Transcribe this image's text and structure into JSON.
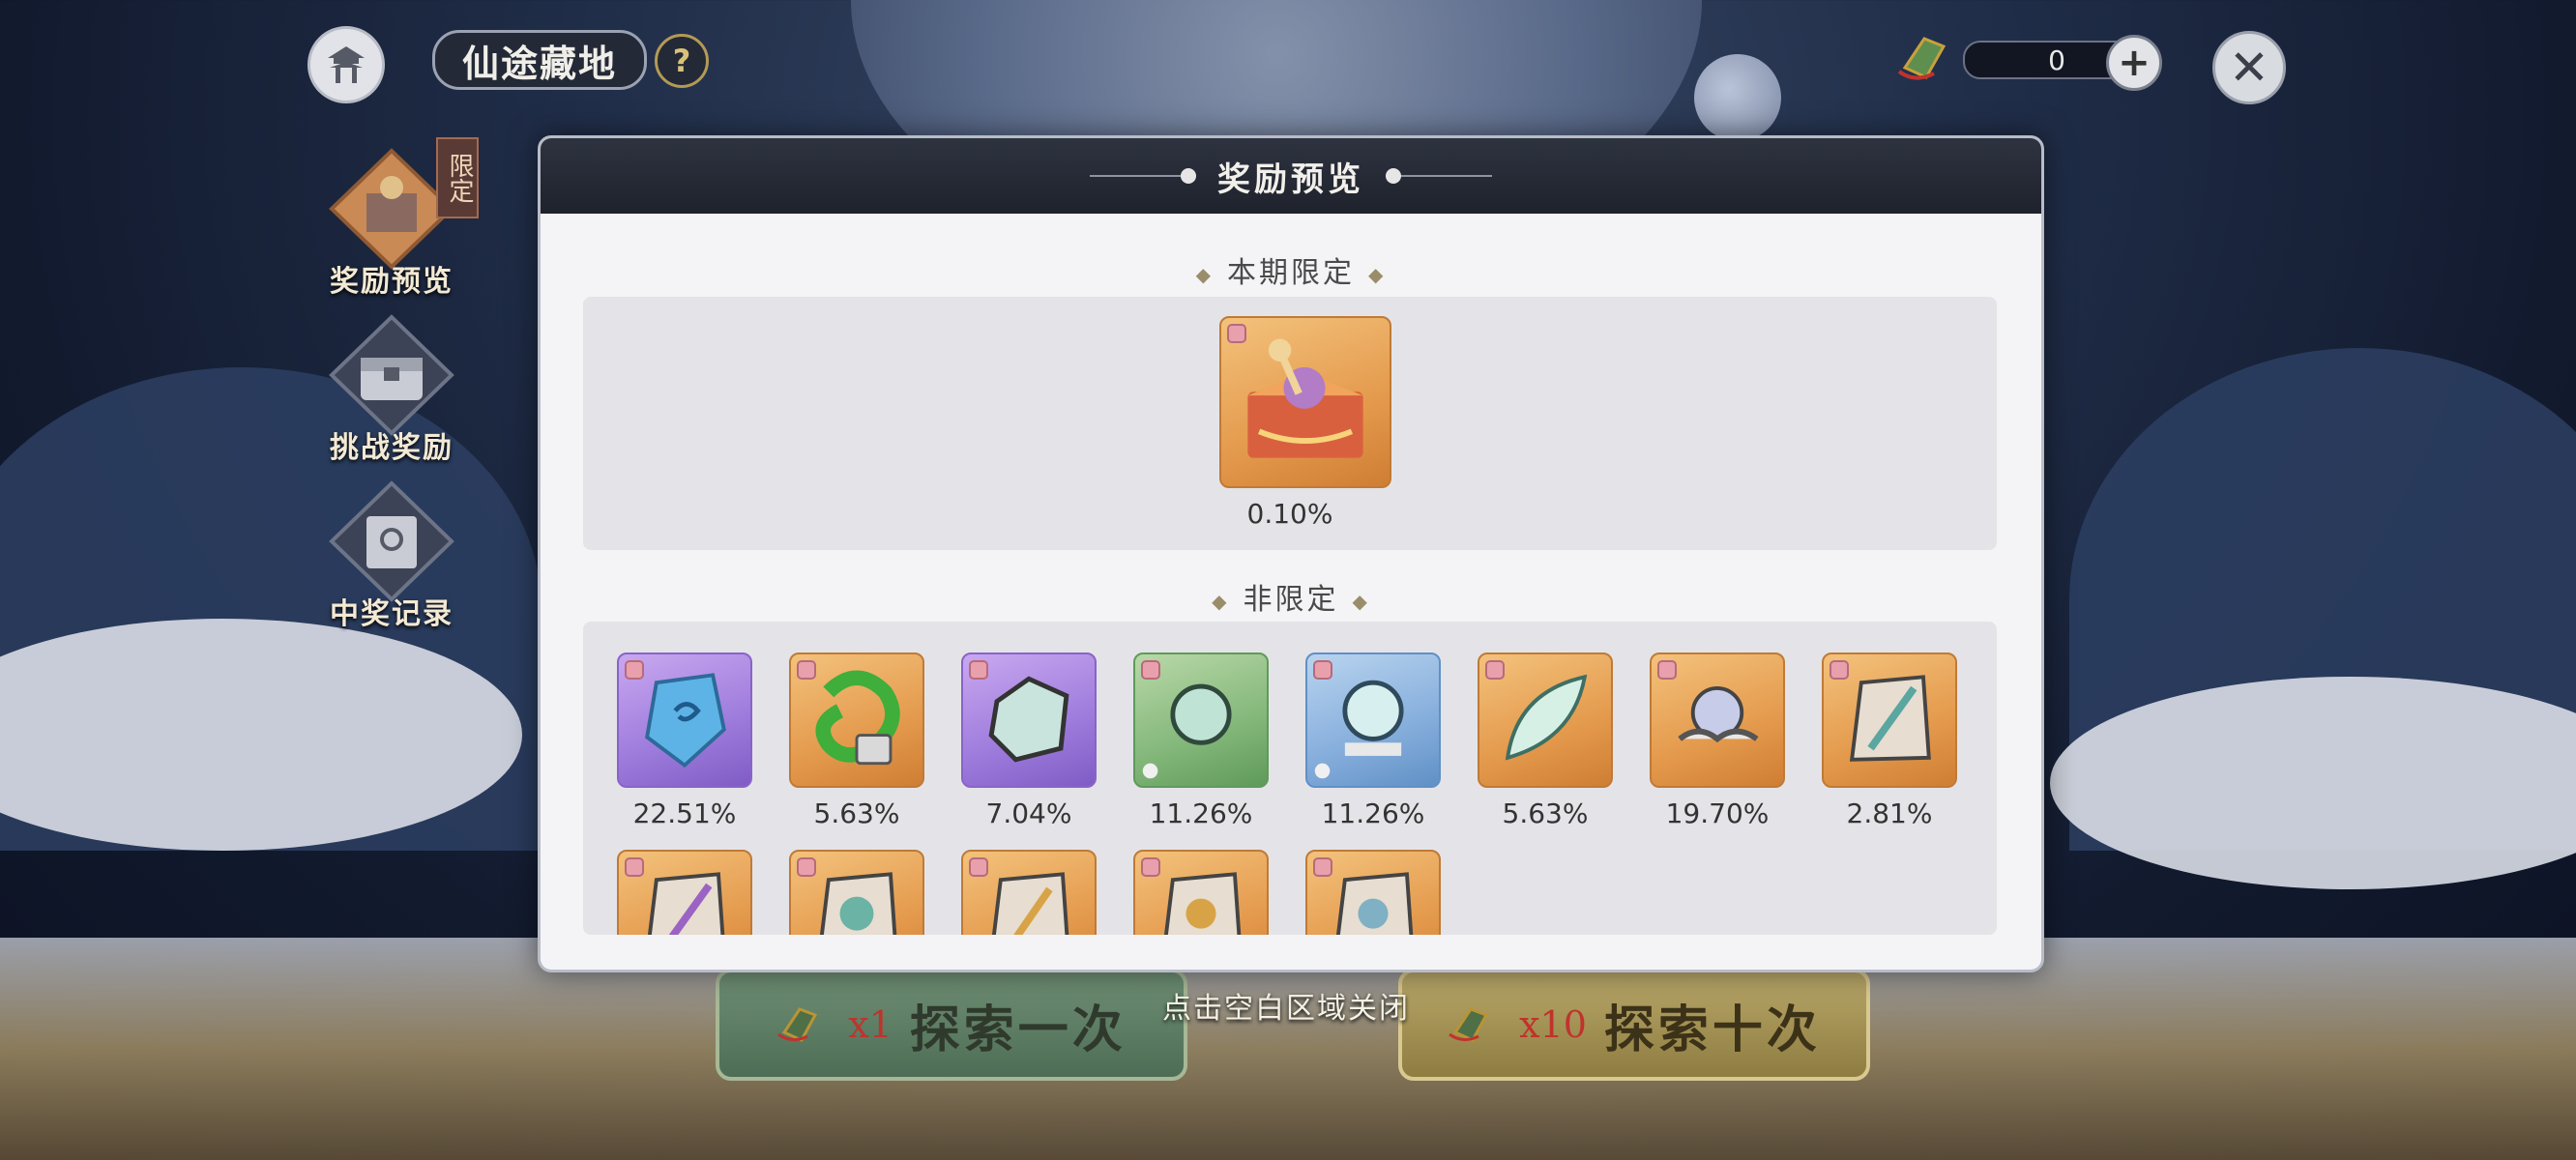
{
  "header": {
    "title": "仙途藏地",
    "help_glyph": "?",
    "currency_amount": "0",
    "plus_glyph": "+",
    "close_glyph": "✕"
  },
  "sidebar": {
    "items": [
      {
        "label": "奖励预览",
        "icon": "treasure-icon"
      },
      {
        "label": "挑战奖励",
        "icon": "chest-icon"
      },
      {
        "label": "中奖记录",
        "icon": "scroll-icon"
      }
    ],
    "limited_tag": "限定"
  },
  "modal": {
    "title": "奖励预览",
    "limited_section": {
      "title": "本期限定",
      "items": [
        {
          "percent": "0.10%",
          "rarity": "gold",
          "icon": "treasure-box-icon"
        }
      ]
    },
    "normal_section": {
      "title": "非限定",
      "items": [
        {
          "percent": "22.51%",
          "rarity": "purple",
          "icon": "spirit-stone-icon"
        },
        {
          "percent": "5.63%",
          "rarity": "gold",
          "icon": "dragon-lock-icon"
        },
        {
          "percent": "7.04%",
          "rarity": "purple",
          "icon": "jade-stone-icon"
        },
        {
          "percent": "11.26%",
          "rarity": "green",
          "icon": "spirit-orb-icon"
        },
        {
          "percent": "11.26%",
          "rarity": "blue",
          "icon": "crystal-orb-icon"
        },
        {
          "percent": "5.63%",
          "rarity": "gold",
          "icon": "feather-icon"
        },
        {
          "percent": "19.70%",
          "rarity": "gold",
          "icon": "cloud-pearl-icon"
        },
        {
          "percent": "2.81%",
          "rarity": "gold",
          "icon": "weapon-fragment-icon"
        },
        {
          "percent": "",
          "rarity": "gold",
          "icon": "staff-fragment-icon"
        },
        {
          "percent": "",
          "rarity": "gold",
          "icon": "artifact-fragment-icon"
        },
        {
          "percent": "",
          "rarity": "gold",
          "icon": "blade-fragment-icon"
        },
        {
          "percent": "",
          "rarity": "gold",
          "icon": "relic-fragment-icon"
        },
        {
          "percent": "",
          "rarity": "gold",
          "icon": "mask-fragment-icon"
        }
      ]
    }
  },
  "footer": {
    "explore_once": {
      "cost": "x1",
      "label": "探索一次"
    },
    "explore_ten": {
      "cost": "x10",
      "label": "探索十次"
    },
    "close_hint": "点击空白区域关闭"
  },
  "colors": {
    "gold": "#e49a4d",
    "purple": "#9d7bdc",
    "green": "#83b77a",
    "blue": "#86aedc",
    "cost_red": "#c0332d"
  }
}
